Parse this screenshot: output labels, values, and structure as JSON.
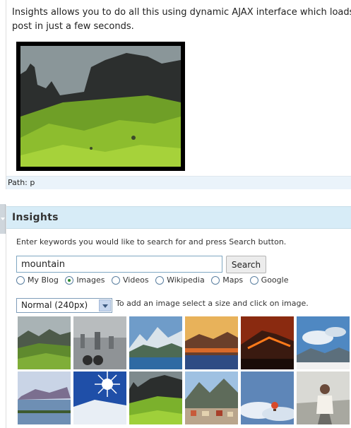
{
  "editor": {
    "text_line1": "Insights allows you to do all this using dynamic AJAX interface which loads t",
    "text_line2": "post in just a few seconds.",
    "path_label": "Path:",
    "path_value": "p"
  },
  "insights": {
    "title": "Insights",
    "instructions": "Enter keywords you would like to search for and press Search button.",
    "search_value": "mountain",
    "search_button": "Search",
    "sources": [
      {
        "label": "My Blog",
        "checked": false
      },
      {
        "label": "Images",
        "checked": true
      },
      {
        "label": "Videos",
        "checked": false
      },
      {
        "label": "Wikipedia",
        "checked": false
      },
      {
        "label": "Maps",
        "checked": false
      },
      {
        "label": "Google",
        "checked": false
      }
    ],
    "size_selected": "Normal (240px)",
    "size_hint": "To add an image select a size and click on image.",
    "thumbnails": [
      {
        "name": "green-valley"
      },
      {
        "name": "city-view"
      },
      {
        "name": "snowy-peaks-lake"
      },
      {
        "name": "sunset-mountains"
      },
      {
        "name": "volcano-night"
      },
      {
        "name": "cloudy-sky-mountains"
      },
      {
        "name": "lake-mountain"
      },
      {
        "name": "snow-sunburst"
      },
      {
        "name": "storr-green-valley"
      },
      {
        "name": "alpine-town"
      },
      {
        "name": "balloon-clouds"
      },
      {
        "name": "road-portrait"
      }
    ]
  }
}
